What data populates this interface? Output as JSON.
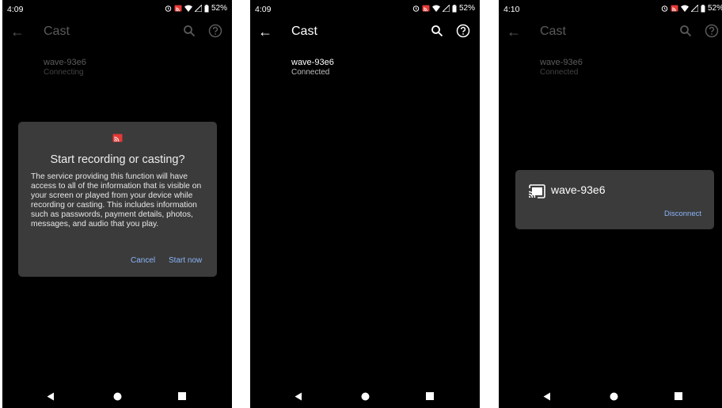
{
  "screens": [
    {
      "status": {
        "time": "4:09",
        "battery": "52%"
      },
      "appbar": {
        "title": "Cast"
      },
      "device": {
        "name": "wave-93e6",
        "state": "Connecting"
      },
      "dialog": {
        "title": "Start recording or casting?",
        "body": "The service providing this function will have access to all of the information that is visible on your screen or played from your device while recording or casting. This includes information such as passwords, payment details, photos, messages, and audio that you play.",
        "cancel": "Cancel",
        "start": "Start now"
      }
    },
    {
      "status": {
        "time": "4:09",
        "battery": "52%"
      },
      "appbar": {
        "title": "Cast"
      },
      "device": {
        "name": "wave-93e6",
        "state": "Connected"
      }
    },
    {
      "status": {
        "time": "4:10",
        "battery": "52%"
      },
      "appbar": {
        "title": "Cast"
      },
      "device": {
        "name": "wave-93e6",
        "state": "Connected"
      },
      "cast_card": {
        "name": "wave-93e6",
        "action": "Disconnect"
      }
    }
  ],
  "icons": {
    "back": "arrow-left-icon",
    "search": "search-icon",
    "help": "help-icon",
    "cast": "cast-icon"
  },
  "colors": {
    "accent": "#8ab4f8",
    "dialog_bg": "#3b3b3b",
    "cast_icon": "#e53935"
  }
}
